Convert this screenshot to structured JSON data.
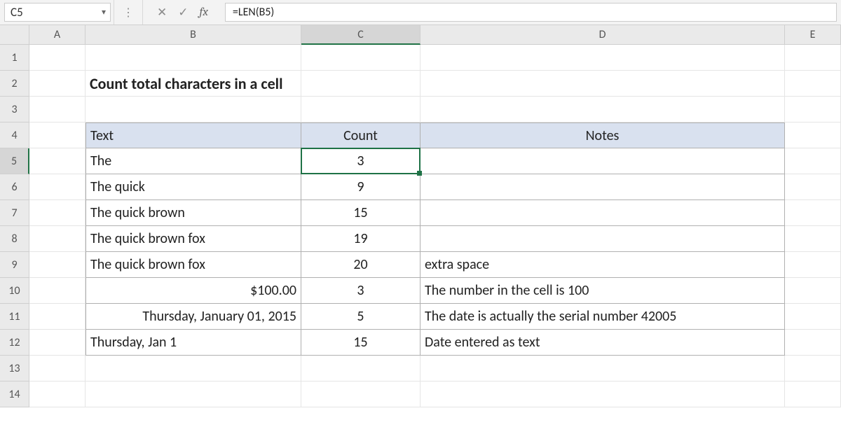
{
  "name_box": "C5",
  "formula": "=LEN(B5)",
  "icons": {
    "cancel": "✕",
    "confirm": "✓",
    "fx": "fx",
    "dropdown": "▾",
    "sep": "⋮"
  },
  "cols": {
    "A": "A",
    "B": "B",
    "C": "C",
    "D": "D",
    "E": "E"
  },
  "rownums": [
    "1",
    "2",
    "3",
    "4",
    "5",
    "6",
    "7",
    "8",
    "9",
    "10",
    "11",
    "12",
    "13",
    "14"
  ],
  "title": "Count total characters in a cell",
  "headers": {
    "text": "Text",
    "count": "Count",
    "notes": "Notes"
  },
  "data": [
    {
      "text": "The",
      "count": "3",
      "notes": ""
    },
    {
      "text": "The quick",
      "count": "9",
      "notes": ""
    },
    {
      "text": "The quick brown",
      "count": "15",
      "notes": ""
    },
    {
      "text": "The quick brown fox",
      "count": "19",
      "notes": ""
    },
    {
      "text": "The quick brown  fox",
      "count": "20",
      "notes": "extra space"
    },
    {
      "text": "$100.00",
      "count": "3",
      "notes": "The number in the cell is 100",
      "align": "right"
    },
    {
      "text": "Thursday, January 01, 2015",
      "count": "5",
      "notes": "The date is actually the serial number 42005",
      "align": "right"
    },
    {
      "text": "Thursday, Jan 1",
      "count": "15",
      "notes": "Date entered as text"
    }
  ],
  "colors": {
    "select_green": "#1f7246",
    "header_fill": "#d9e1ef"
  }
}
